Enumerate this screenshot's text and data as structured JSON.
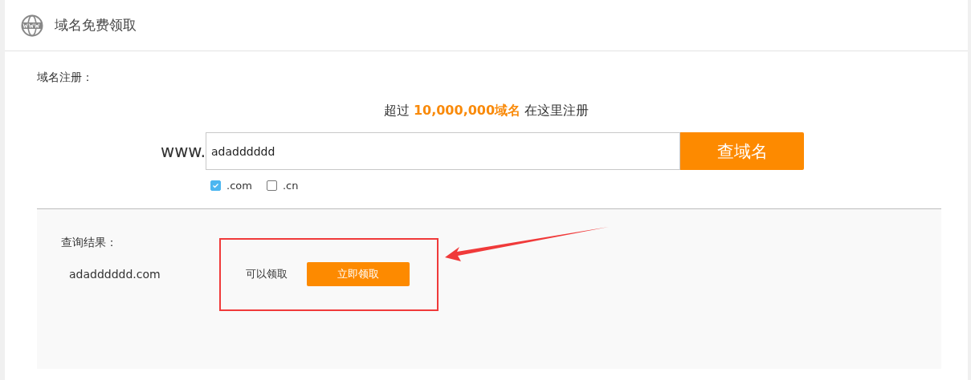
{
  "header": {
    "title": "域名免费领取"
  },
  "section_label": "域名注册：",
  "headline": "超过 **10,000,000域名** 在这里注册",
  "search": {
    "prefix": "www.",
    "value": "adadddddd",
    "button": "查域名"
  },
  "suffixes": [
    {
      "label": ".com",
      "checked": true
    },
    {
      "label": ".cn",
      "checked": false
    }
  ],
  "results": {
    "label": "查询结果：",
    "rows": [
      {
        "domain": "adadddddd.com",
        "status": "可以领取",
        "action": "立即领取"
      }
    ]
  },
  "annotation": {
    "highlight": true,
    "arrow": true
  }
}
